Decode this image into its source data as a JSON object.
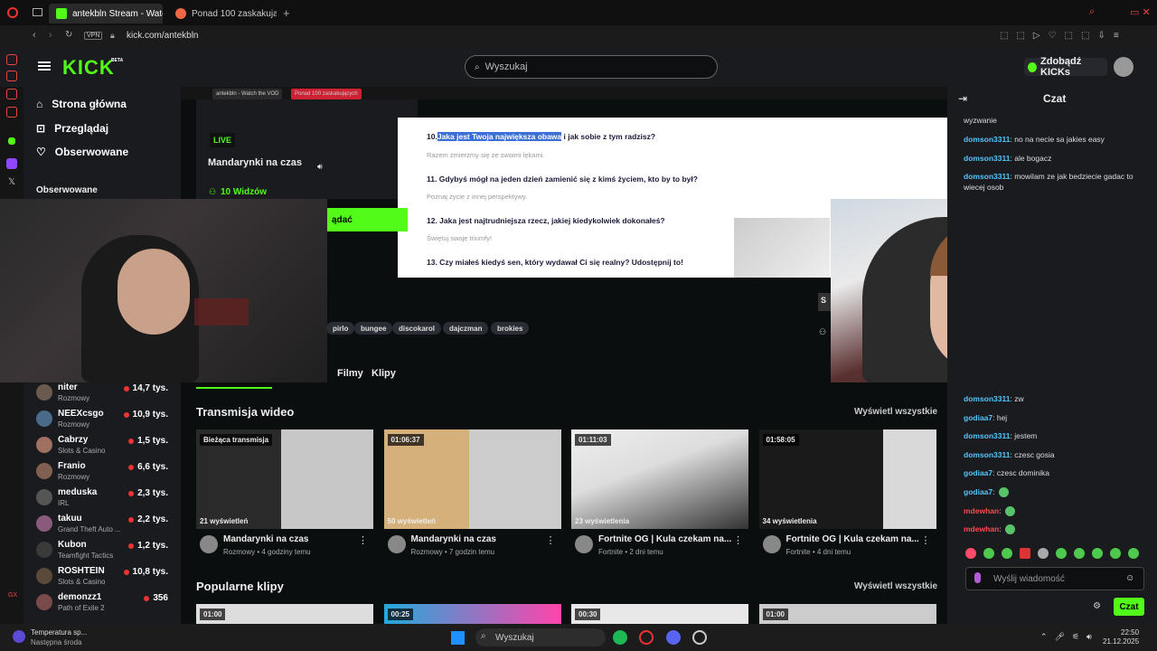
{
  "browser": {
    "tabs": [
      {
        "label": "antekbln Stream - Watch t",
        "active": true
      },
      {
        "label": "Ponad 100 zaskakujących",
        "active": false
      }
    ],
    "vpn": "VPN",
    "url": "kick.com/antekbln"
  },
  "header": {
    "logo": "KICK",
    "logo_sup": "BETA",
    "search_placeholder": "Wyszukaj",
    "kicks_label": "Zdobądź KICKs"
  },
  "sidebar": {
    "nav": [
      {
        "label": "Strona główna",
        "icon": "home-icon"
      },
      {
        "label": "Przeglądaj",
        "icon": "browse-icon"
      },
      {
        "label": "Obserwowane",
        "icon": "heart-icon"
      }
    ],
    "followed_title": "Obserwowane",
    "channels": [
      {
        "name": "niter",
        "category": "Rozmowy",
        "viewers": "14,7 tys."
      },
      {
        "name": "NEEXcsgo",
        "category": "Rozmowy",
        "viewers": "10,9 tys."
      },
      {
        "name": "Cabrzy",
        "category": "Slots & Casino",
        "viewers": "1,5 tys."
      },
      {
        "name": "Franio",
        "category": "Rozmowy",
        "viewers": "6,6 tys."
      },
      {
        "name": "meduska",
        "category": "IRL",
        "viewers": "2,3 tys."
      },
      {
        "name": "takuu",
        "category": "Grand Theft Auto ...",
        "viewers": "2,2 tys."
      },
      {
        "name": "Kubon",
        "category": "Teamfight Tactics",
        "viewers": "1,2 tys."
      },
      {
        "name": "ROSHTEIN",
        "category": "Slots & Casino",
        "viewers": "10,8 tys."
      },
      {
        "name": "demonzz1",
        "category": "Path of Exile 2",
        "viewers": "356"
      }
    ]
  },
  "embedded": {
    "tabs": [
      "antekbln - Watch the VOD",
      "Ponad 100 zaskakujących"
    ],
    "live_badge": "LIVE",
    "live_title": "Mandarynki na czas",
    "live_viewers": "10 Widzów",
    "follow_label": "ądać",
    "questions": [
      {
        "num": "10.",
        "highlight": "Jaka jest Twoja największa obawa",
        "rest": "i jak sobie z tym radzisz?",
        "sub": "Razem zmierzmy się ze swoimi lękami."
      },
      {
        "num": "",
        "highlight": "",
        "rest": "11. Gdybyś mógł na jeden dzień zamienić się z kimś życiem, kto by to był?",
        "sub": "Poznaj życie z innej perspektywy."
      },
      {
        "num": "",
        "highlight": "",
        "rest": "12. Jaka jest najtrudniejsza rzecz, jakiej kiedykolwiek dokonałeś?",
        "sub": "Świętuj swoje triumfy!"
      },
      {
        "num": "",
        "highlight": "",
        "rest": "13. Czy miałeś kiedyś sen, który wydawał Ci się realny? Udostępnij to!",
        "sub": ""
      }
    ]
  },
  "tags": [
    "pirlo",
    "bungee",
    "discokarol",
    "dajczman",
    "brokies"
  ],
  "subtabs": [
    "Filmy",
    "Klipy"
  ],
  "videos_section": {
    "title": "Transmisja wideo",
    "see_all": "Wyświetl wszystkie",
    "cards": [
      {
        "badge": "Bieżąca transmisja",
        "views": "21 wyświetleń",
        "title": "Mandarynki na czas",
        "category": "Rozmowy",
        "age": "4 godziny temu"
      },
      {
        "badge": "01:06:37",
        "views": "50 wyświetleń",
        "title": "Mandarynki na czas",
        "category": "Rozmowy",
        "age": "7 godzin temu"
      },
      {
        "badge": "01:11:03",
        "views": "23 wyświetlenia",
        "title": "Fortnite OG | Kula czekam na...",
        "category": "Fortnite",
        "age": "2 dni temu"
      },
      {
        "badge": "01:58:05",
        "views": "34 wyświetlenia",
        "title": "Fortnite OG | Kula czekam na...",
        "category": "Fortnite",
        "age": "4 dni temu"
      }
    ]
  },
  "clips_section": {
    "title": "Popularne klipy",
    "see_all": "Wyświetl wszystkie",
    "badges": [
      "01:00",
      "00:25",
      "00:30",
      "01:00"
    ]
  },
  "chat": {
    "title": "Czat",
    "messages_top": [
      {
        "user": "",
        "text": "wyzwanie"
      },
      {
        "user": "domson3311",
        "text": ": no na necie sa jakies easy"
      },
      {
        "user": "domson3311",
        "text": ": ale bogacz"
      },
      {
        "user": "domson3311",
        "text": ": mowilam ze jak bedziecie gadac to wiecej osob"
      }
    ],
    "messages_bottom": [
      {
        "user": "domson3311",
        "text": ": zw",
        "red": false
      },
      {
        "user": "godiaa7",
        "text": ": hej",
        "red": false
      },
      {
        "user": "domson3311",
        "text": ": jestem",
        "red": false
      },
      {
        "user": "domson3311",
        "text": ": czesc gosia",
        "red": false
      },
      {
        "user": "godiaa7",
        "text": ": czesc dominika",
        "red": false
      },
      {
        "user": "godiaa7",
        "text": ":",
        "red": false,
        "emote": true
      },
      {
        "user": "mdewhan",
        "text": ":",
        "red": true,
        "emote": true
      },
      {
        "user": "mdewhan",
        "text": ":",
        "red": true,
        "emote": true
      }
    ],
    "input_placeholder": "Wyślij wiadomość",
    "send_label": "Czat"
  },
  "taskbar": {
    "weather_title": "Temperatura sp...",
    "weather_sub": "Następna środa",
    "search": "Wyszukaj",
    "time": "22:50",
    "date": "21.12.2025"
  },
  "colors": {
    "accent": "#53fc18",
    "background": "#0b0e0f",
    "panel": "#191b1f"
  }
}
